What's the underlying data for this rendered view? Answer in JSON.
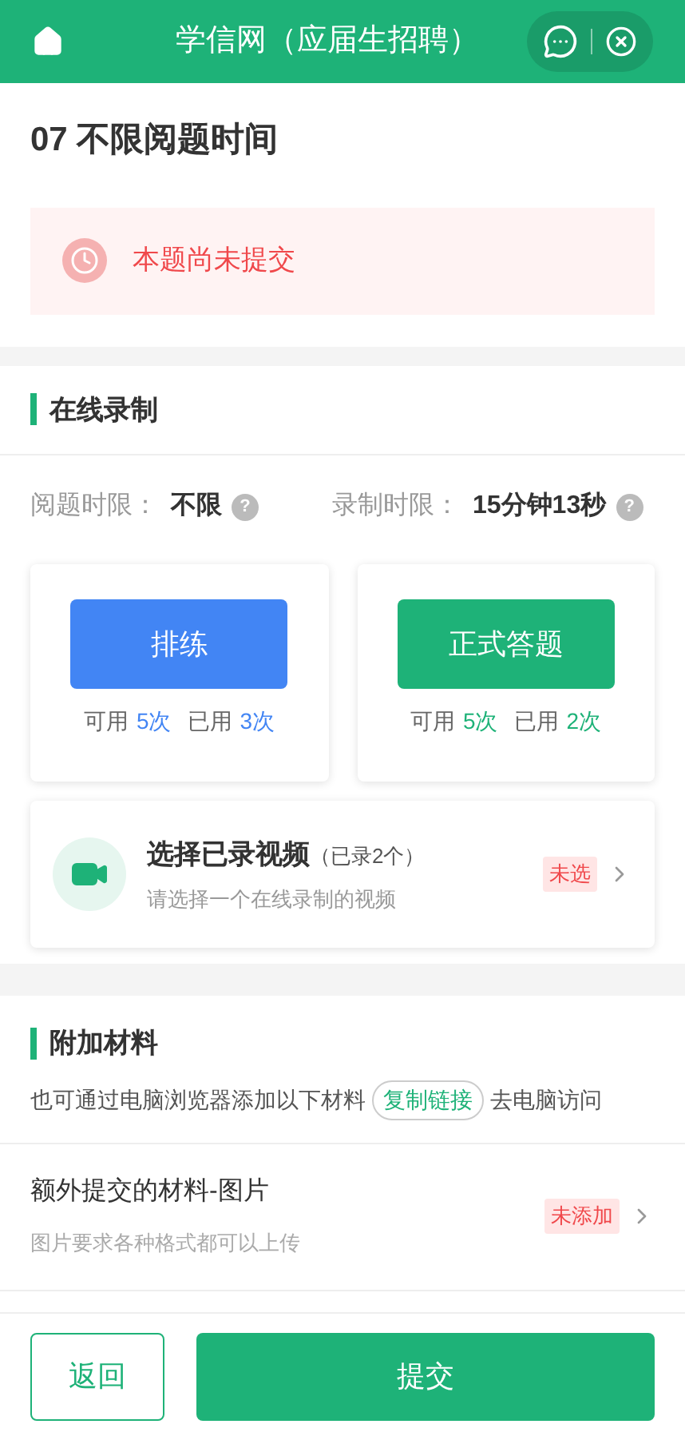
{
  "header": {
    "title": "学信网（应届生招聘）"
  },
  "question": {
    "title": "07 不限阅题时间",
    "notice": "本题尚未提交"
  },
  "recording": {
    "section_title": "在线录制",
    "limits": [
      {
        "label": "阅题时限：",
        "value": "不限",
        "help": "?"
      },
      {
        "label": "录制时限：",
        "value": "15分钟13秒",
        "help": "?"
      }
    ],
    "modes": [
      {
        "kind": "practice",
        "button": "排练",
        "stats": [
          {
            "label": "可用",
            "value": "5次"
          },
          {
            "label": "已用",
            "value": "3次"
          }
        ]
      },
      {
        "kind": "formal",
        "button": "正式答题",
        "stats": [
          {
            "label": "可用",
            "value": "5次"
          },
          {
            "label": "已用",
            "value": "2次"
          }
        ]
      }
    ],
    "video": {
      "title": "选择已录视频",
      "count": "（已录2个）",
      "hint": "请选择一个在线录制的视频",
      "status": "未选"
    }
  },
  "materials": {
    "section_title": "附加材料",
    "intro_before": "也可通过电脑浏览器添加以下材料",
    "copy_link": "复制链接",
    "intro_after": "去电脑访问",
    "items": [
      {
        "title": "额外提交的材料-图片",
        "hint": "图片要求各种格式都可以上传",
        "status": "未添加"
      }
    ]
  },
  "footer": {
    "back": "返回",
    "submit": "提交"
  }
}
